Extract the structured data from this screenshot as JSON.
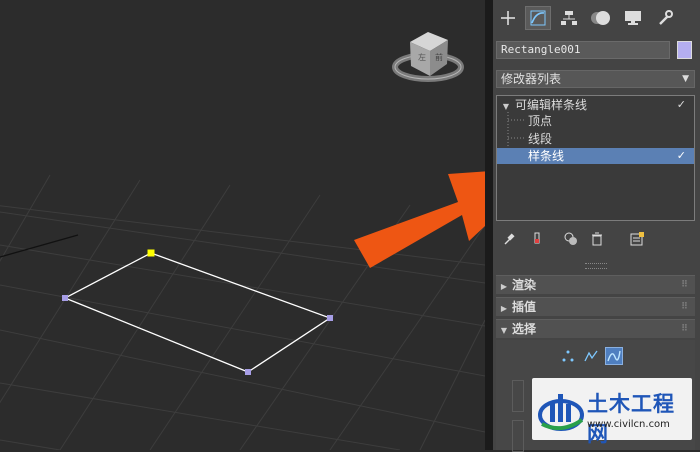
{
  "command_panel": {
    "tabs": [
      {
        "name": "create-tab",
        "icon": "plus-icon"
      },
      {
        "name": "modify-tab",
        "icon": "modify-curve-icon"
      },
      {
        "name": "hierarchy-tab",
        "icon": "hierarchy-icon"
      },
      {
        "name": "motion-tab",
        "icon": "motion-icon"
      },
      {
        "name": "display-tab",
        "icon": "monitor-icon"
      },
      {
        "name": "utilities-tab",
        "icon": "wrench-icon"
      }
    ],
    "active_tab": "modify-tab",
    "object_name": "Rectangle001",
    "object_color": "#b4aef0",
    "modifier_list_label": "修改器列表",
    "stack": {
      "root": "可编辑样条线",
      "children": [
        "顶点",
        "线段",
        "样条线"
      ],
      "selected": "样条线"
    },
    "rollouts": [
      {
        "label": "渲染",
        "expanded": false
      },
      {
        "label": "插值",
        "expanded": false
      },
      {
        "label": "选择",
        "expanded": true
      }
    ],
    "selection_modes": [
      "vertex-mode",
      "segment-mode",
      "spline-mode"
    ],
    "active_selection_mode": "spline-mode"
  },
  "viewport": {
    "object": "Rectangle001",
    "spline_color": "#ffffff",
    "vertex_color": "#a79ee6",
    "first_vertex_color": "#ffff00"
  },
  "overlay": {
    "arrow_color": "#ee5613"
  },
  "watermark": {
    "title": "土木工程网",
    "url": "www.civilcn.com"
  }
}
